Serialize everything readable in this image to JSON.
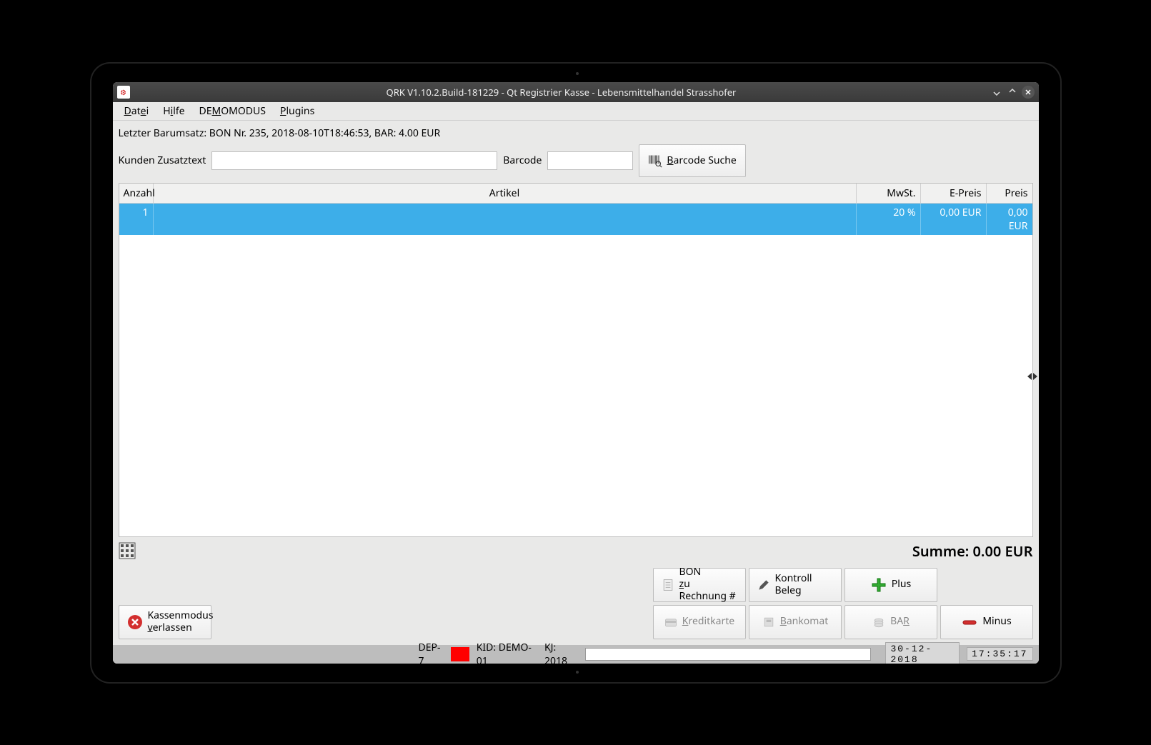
{
  "titlebar": {
    "title": "QRK V1.10.2.Build-181229 - Qt Registrier Kasse - Lebensmittelhandel Strasshofer"
  },
  "menu": {
    "datei": "Datei",
    "hilfe": "Hilfe",
    "demo": "DEMOMODUS",
    "plugins": "Plugins"
  },
  "info": {
    "last_revenue": "Letzter Barumsatz: BON Nr. 235, 2018-08-10T18:46:53, BAR: 4.00 EUR"
  },
  "inputs": {
    "kunden_label": "Kunden Zusatztext",
    "kunden_value": "",
    "barcode_label": "Barcode",
    "barcode_value": "",
    "barcode_search_btn": "Barcode Suche"
  },
  "table": {
    "headers": {
      "anzahl": "Anzahl",
      "artikel": "Artikel",
      "mwst": "MwSt.",
      "epreis": "E-Preis",
      "preis": "Preis"
    },
    "rows": [
      {
        "anzahl": "1",
        "artikel": "",
        "mwst": "20 %",
        "epreis": "0,00 EUR",
        "preis": "0,00 EUR"
      }
    ]
  },
  "sum": {
    "label": "Summe: 0.00 EUR"
  },
  "buttons": {
    "exit1": "Kassenmodus",
    "exit2": "verlassen",
    "bon1": "BON",
    "bon2": "zu Rechnung #",
    "kontroll": "Kontroll Beleg",
    "plus": "Plus",
    "kredit": "Kreditkarte",
    "bankomat": "Bankomat",
    "bar": "BAR",
    "minus": "Minus"
  },
  "status": {
    "dep": "DEP-7",
    "kid": "KID: DEMO-01",
    "kj": "KJ: 2018",
    "date": "30-12-2018",
    "time": "17:35:17"
  }
}
